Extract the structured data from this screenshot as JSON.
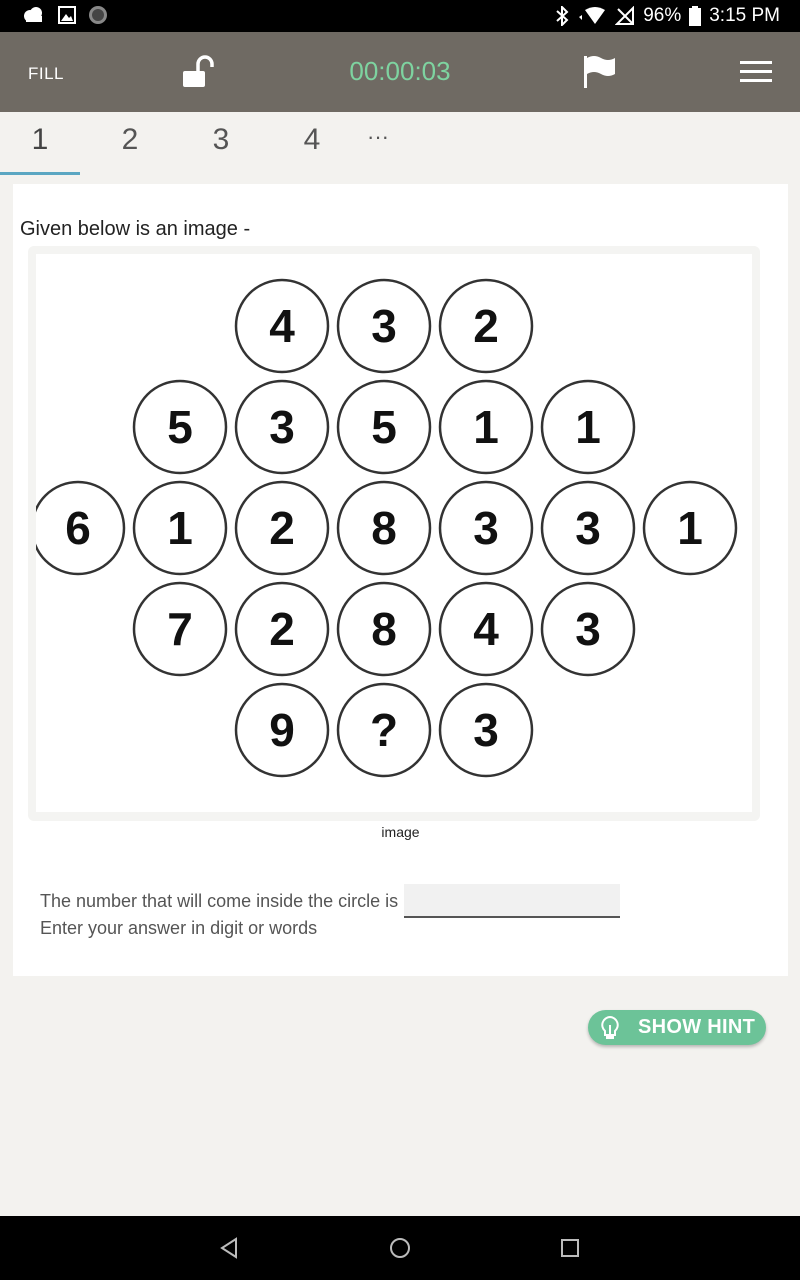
{
  "status_bar": {
    "battery": "96%",
    "time": "3:15 PM",
    "icons": [
      "cloud-icon",
      "image-icon",
      "circle-icon",
      "bluetooth-icon",
      "wifi-icon",
      "no-signal-icon",
      "battery-icon"
    ]
  },
  "toolbar": {
    "mode_label": "FILL",
    "timer": "00:00:03",
    "icons": [
      "unlock-icon",
      "flag-icon",
      "menu-icon"
    ],
    "timer_color": "#7ed3a0",
    "bg_color": "#6f6a63"
  },
  "tabs": [
    {
      "label": "1",
      "active": true
    },
    {
      "label": "2"
    },
    {
      "label": "3"
    },
    {
      "label": "4"
    },
    {
      "label": "···"
    }
  ],
  "question": {
    "intro": "Given below is an image -",
    "caption": "image",
    "prompt": "The number that will come inside the circle is",
    "answer_value": "",
    "instruction": "Enter your answer in digit or words"
  },
  "puzzle": {
    "rows": [
      [
        "4",
        "3",
        "2"
      ],
      [
        "5",
        "3",
        "5",
        "1",
        "1"
      ],
      [
        "6",
        "1",
        "2",
        "8",
        "3",
        "3",
        "1"
      ],
      [
        "7",
        "2",
        "8",
        "4",
        "3"
      ],
      [
        "9",
        "?",
        "3"
      ]
    ]
  },
  "hint": {
    "label": "SHOW HINT",
    "color": "#6cc398"
  }
}
